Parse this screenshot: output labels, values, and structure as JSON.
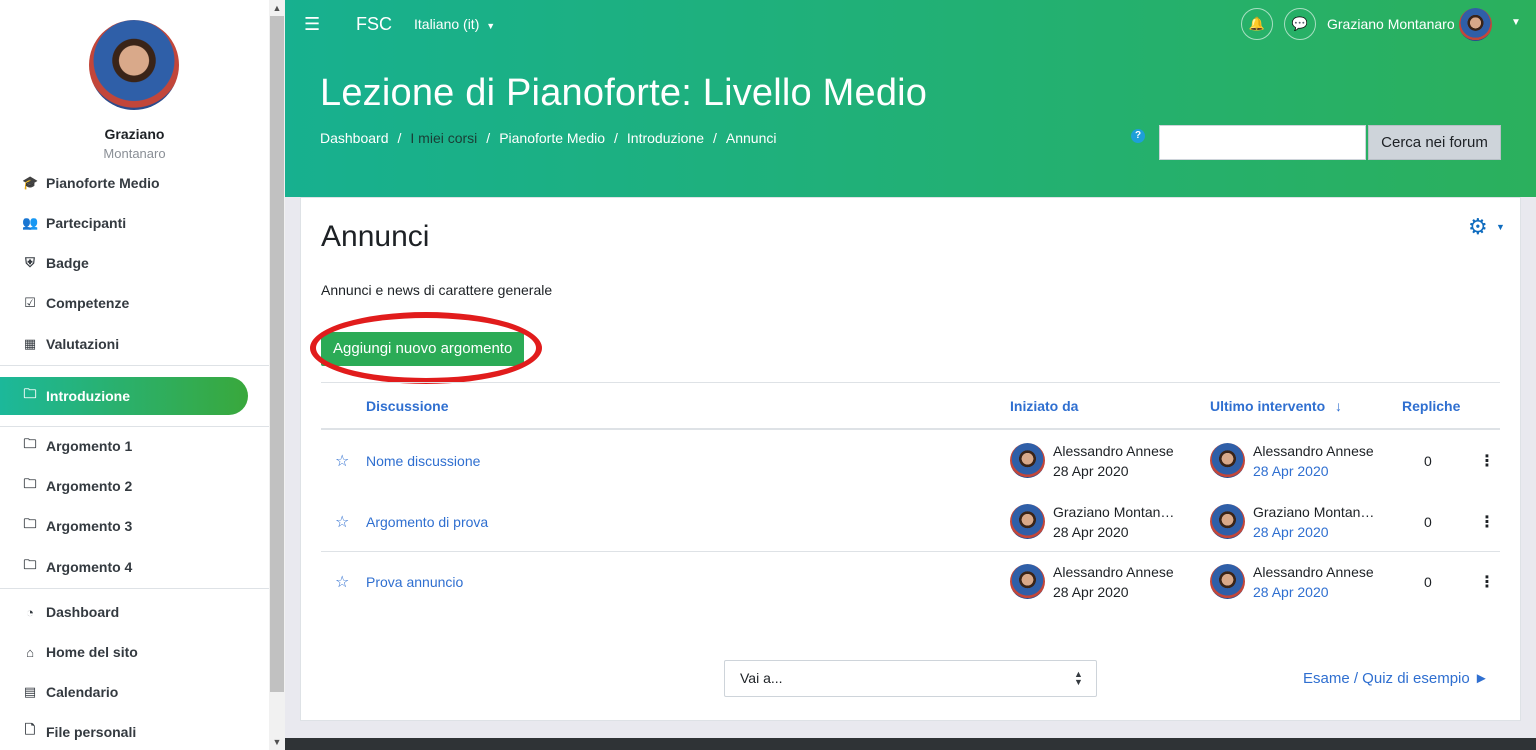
{
  "sidebar": {
    "user_first": "Graziano",
    "user_last": "Montanaro",
    "items": [
      {
        "label": "Pianoforte Medio",
        "icon": "graduation-cap-icon"
      },
      {
        "label": "Partecipanti",
        "icon": "users-icon"
      },
      {
        "label": "Badge",
        "icon": "shield-icon"
      },
      {
        "label": "Competenze",
        "icon": "checkbox-icon"
      },
      {
        "label": "Valutazioni",
        "icon": "table-icon"
      },
      {
        "label": "Introduzione",
        "icon": "folder-icon",
        "active": true
      },
      {
        "label": "Argomento 1",
        "icon": "folder-icon"
      },
      {
        "label": "Argomento 2",
        "icon": "folder-icon"
      },
      {
        "label": "Argomento 3",
        "icon": "folder-icon"
      },
      {
        "label": "Argomento 4",
        "icon": "folder-icon"
      },
      {
        "label": "Dashboard",
        "icon": "dashboard-icon"
      },
      {
        "label": "Home del sito",
        "icon": "home-icon"
      },
      {
        "label": "Calendario",
        "icon": "calendar-icon"
      },
      {
        "label": "File personali",
        "icon": "file-icon"
      }
    ]
  },
  "topbar": {
    "brand": "FSC",
    "language": "Italiano (it)",
    "user_name": "Graziano Montanaro"
  },
  "header": {
    "title": "Lezione di Pianoforte: Livello Medio",
    "breadcrumb": [
      "Dashboard",
      "I miei corsi",
      "Pianoforte Medio",
      "Introduzione",
      "Annunci"
    ],
    "search_value": "",
    "search_button": "Cerca nei forum"
  },
  "forum": {
    "title": "Annunci",
    "intro": "Annunci e news di carattere generale",
    "add_button": "Aggiungi nuovo argomento",
    "columns": {
      "discussion": "Discussione",
      "started_by": "Iniziato da",
      "last_post": "Ultimo intervento",
      "replies": "Repliche"
    },
    "rows": [
      {
        "title": "Nome discussione",
        "starter": "Alessandro Annese",
        "start_date": "28 Apr 2020",
        "last_by": "Alessandro Annese",
        "last_date": "28 Apr 2020",
        "replies": "0"
      },
      {
        "title": "Argomento di prova",
        "starter": "Graziano Montanaro",
        "start_date": "28 Apr 2020",
        "last_by": "Graziano Montanaro",
        "last_date": "28 Apr 2020",
        "replies": "0"
      },
      {
        "title": "Prova annuncio",
        "starter": "Alessandro Annese",
        "start_date": "28 Apr 2020",
        "last_by": "Alessandro Annese",
        "last_date": "28 Apr 2020",
        "replies": "0"
      }
    ],
    "jump_select": "Vai a...",
    "next_link": "Esame / Quiz di esempio ►"
  },
  "colors": {
    "band_start": "#17b08f",
    "band_end": "#2bb05d",
    "link": "#2f6fd0",
    "add_button": "#2bab56",
    "highlight_ring": "#e11c1c"
  }
}
